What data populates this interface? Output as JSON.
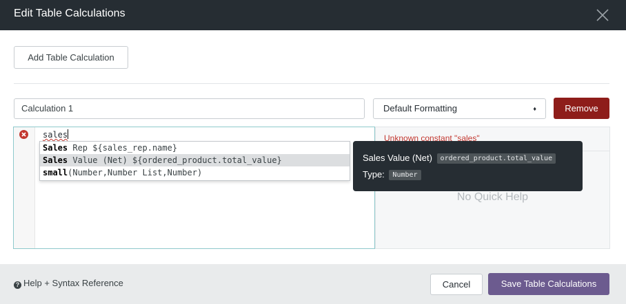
{
  "dialog": {
    "title": "Edit Table Calculations",
    "close_icon": "close-icon"
  },
  "toolbar": {
    "add_label": "Add Table Calculation"
  },
  "calculation": {
    "name_value": "Calculation 1",
    "format_value": "Default Formatting",
    "remove_label": "Remove"
  },
  "editor": {
    "code": "sales",
    "error_icon": "error-icon",
    "error_text": "Unknown constant \"sales\"",
    "no_help_text": "No Quick Help"
  },
  "autocomplete": {
    "items": [
      {
        "match": "Sales",
        "rest": " Rep ${sales_rep.name}"
      },
      {
        "match": "Sales",
        "rest": " Value (Net) ${ordered_product.total_value}"
      },
      {
        "match": "small",
        "rest": "(Number,Number List,Number)"
      }
    ],
    "selected_index": 1
  },
  "tooltip": {
    "label": "Sales Value (Net)",
    "field": "ordered_product.total_value",
    "type_label": "Type:",
    "type_value": "Number"
  },
  "footer": {
    "help_label": "Help + Syntax Reference",
    "cancel_label": "Cancel",
    "save_label": "Save Table Calculations"
  },
  "colors": {
    "header_bg": "#262d33",
    "remove_bg": "#8e1d1a",
    "save_bg": "#6c5b8f",
    "error": "#c2372f",
    "editor_border": "#8ec9cc"
  }
}
